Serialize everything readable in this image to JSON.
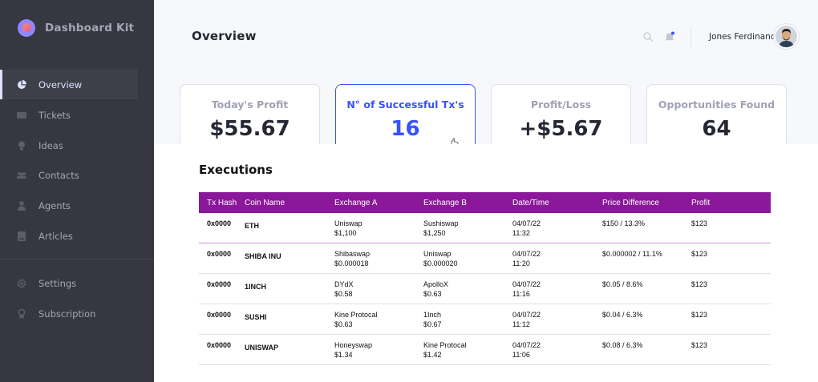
{
  "app": {
    "name": "Dashboard Kit"
  },
  "sidebar": {
    "items": [
      {
        "label": "Overview",
        "icon": "pie-chart-icon"
      },
      {
        "label": "Tickets",
        "icon": "ticket-icon"
      },
      {
        "label": "Ideas",
        "icon": "lightbulb-icon"
      },
      {
        "label": "Contacts",
        "icon": "people-icon"
      },
      {
        "label": "Agents",
        "icon": "person-icon"
      },
      {
        "label": "Articles",
        "icon": "book-icon"
      },
      {
        "label": "Settings",
        "icon": "gear-icon"
      },
      {
        "label": "Subscription",
        "icon": "award-icon"
      }
    ],
    "active": "Overview"
  },
  "header": {
    "title": "Overview",
    "user_name": "Jones Ferdinand"
  },
  "cards": [
    {
      "title": "Today's Profit",
      "value": "$55.67"
    },
    {
      "title": "N° of Successful Tx's",
      "value": "16"
    },
    {
      "title": "Profit/Loss",
      "value": "+$5.67"
    },
    {
      "title": "Opportunities Found",
      "value": "64"
    }
  ],
  "executions": {
    "title": "Executions",
    "columns": [
      "Tx Hash",
      "Coin Name",
      "Exchange A",
      "Exchange B",
      "Date/Time",
      "Price Difference",
      "Profit"
    ],
    "rows": [
      {
        "tx": "0x0000",
        "coin": "ETH",
        "exA": "Uniswap",
        "exA_price": "$1,100",
        "exB": "Sushiswap",
        "exB_price": "$1,250",
        "date": "04/07/22",
        "time": "11:32",
        "diff": "$150  /  13.3%",
        "profit": "$123"
      },
      {
        "tx": "0x0000",
        "coin": "SHIBA INU",
        "exA": "Shibaswap",
        "exA_price": "$0.000018",
        "exB": "Uniswap",
        "exB_price": "$0.000020",
        "date": "04/07/22",
        "time": "11:20",
        "diff": "$0.000002  /  11.1%",
        "profit": "$123"
      },
      {
        "tx": "0x0000",
        "coin": "1INCH",
        "exA": "DYdX",
        "exA_price": "$0.58",
        "exB": "ApolloX",
        "exB_price": "$0.63",
        "date": "04/07/22",
        "time": "11:16",
        "diff": "$0.05  /  8.6%",
        "profit": "$123"
      },
      {
        "tx": "0x0000",
        "coin": "SUSHI",
        "exA": "Kine Protocal",
        "exA_price": "$0.63",
        "exB": "1Inch",
        "exB_price": "$0.67",
        "date": "04/07/22",
        "time": "11:12",
        "diff": "$0.04  /  6.3%",
        "profit": "$123"
      },
      {
        "tx": "0x0000",
        "coin": "UNISWAP",
        "exA": "Honeyswap",
        "exA_price": "$1.34",
        "exB": "Kine Protocal",
        "exB_price": "$1.42",
        "date": "04/07/22",
        "time": "11:06",
        "diff": "$0.08  /  6.3%",
        "profit": "$123"
      }
    ]
  },
  "colors": {
    "sidebar_bg": "#363740",
    "accent": "#3751ff",
    "table_header": "#8b179a"
  }
}
